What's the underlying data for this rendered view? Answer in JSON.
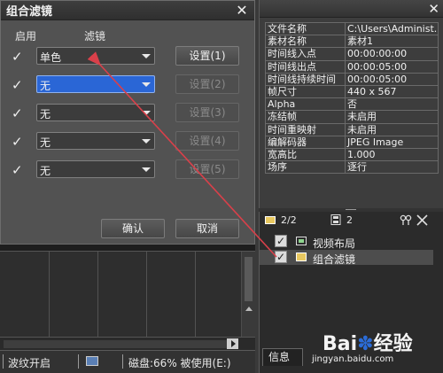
{
  "dialog": {
    "title": "组合滤镜",
    "close_glyph": "✕",
    "headers": {
      "enable": "启用",
      "filter": "滤镜"
    },
    "rows": [
      {
        "checked": true,
        "value": "单色",
        "active": false,
        "settings_label": "设置(1)",
        "settings_enabled": true
      },
      {
        "checked": true,
        "value": "无",
        "active": true,
        "settings_label": "设置(2)",
        "settings_enabled": false
      },
      {
        "checked": true,
        "value": "无",
        "active": false,
        "settings_label": "设置(3)",
        "settings_enabled": false
      },
      {
        "checked": true,
        "value": "无",
        "active": false,
        "settings_label": "设置(4)",
        "settings_enabled": false
      },
      {
        "checked": true,
        "value": "无",
        "active": false,
        "settings_label": "设置(5)",
        "settings_enabled": false
      }
    ],
    "ok_label": "确认",
    "cancel_label": "取消"
  },
  "properties": {
    "rows": [
      {
        "key": "文件名称",
        "value": "C:\\Users\\Administ..."
      },
      {
        "key": "素材名称",
        "value": "素材1"
      },
      {
        "key": "时间线入点",
        "value": "00:00:00:00"
      },
      {
        "key": "时间线出点",
        "value": "00:00:05:00"
      },
      {
        "key": "时间线持续时间",
        "value": "00:00:05:00"
      },
      {
        "key": "帧尺寸",
        "value": "440 x 567"
      },
      {
        "key": "Alpha",
        "value": "否"
      },
      {
        "key": "冻结帧",
        "value": "未启用"
      },
      {
        "key": "时间重映射",
        "value": "未启用"
      },
      {
        "key": "编解码器",
        "value": "JPEG Image"
      },
      {
        "key": "宽高比",
        "value": "1.000"
      },
      {
        "key": "场序",
        "value": "逐行"
      }
    ]
  },
  "layers": {
    "page_indicator": "2/2",
    "count": "2",
    "items": [
      {
        "label": "视频布局",
        "checked": true,
        "selected": false
      },
      {
        "label": "组合滤镜",
        "checked": true,
        "selected": true
      }
    ],
    "info_tab": "信息"
  },
  "statusbar": {
    "ripple": "波纹开启",
    "disk": "磁盘:66% 被使用(E:)"
  },
  "watermark": {
    "logo_a": "Bai",
    "logo_paw": "✽",
    "logo_b": "经验",
    "url": "jingyan.baidu.com"
  },
  "colors": {
    "accent_active_combo": "#2a66d6",
    "annotation_arrow": "#d9404a"
  }
}
